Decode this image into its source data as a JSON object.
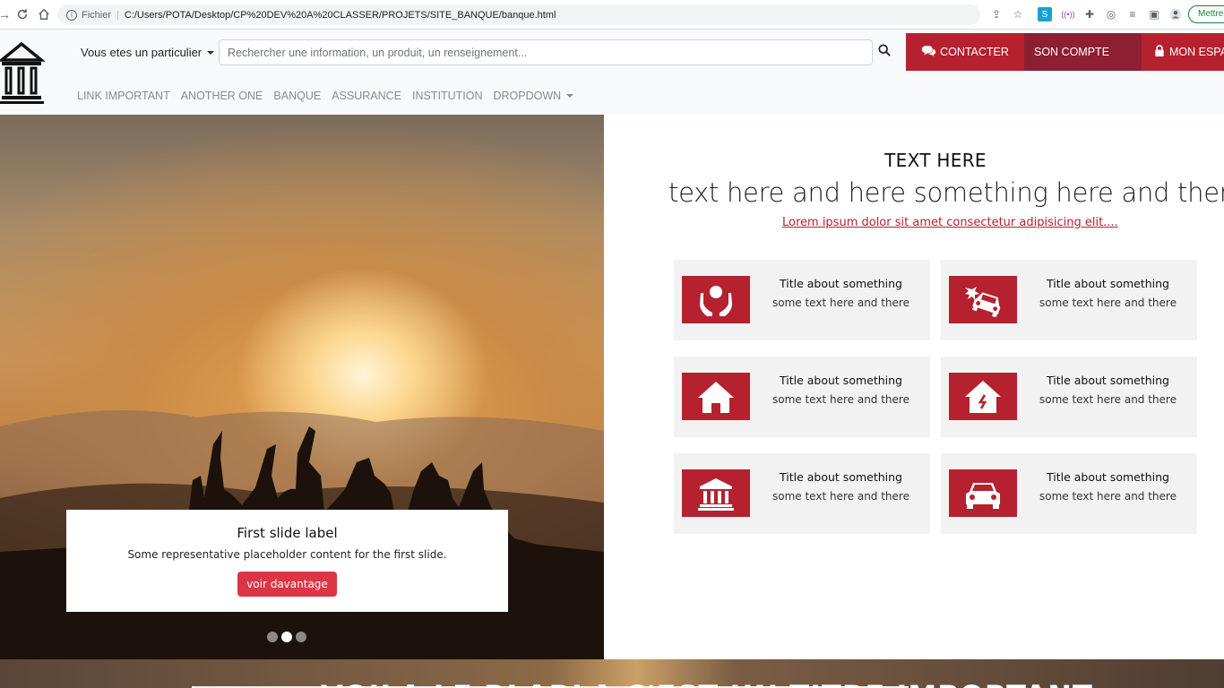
{
  "browser": {
    "fichier_label": "Fichier",
    "url": "C:/Users/POTA/Desktop/CP%20DEV%20A%20CLASSER/PROJETS/SITE_BANQUE/banque.html",
    "update_label": "Mettre"
  },
  "header": {
    "particulier": "Vous etes un particulier",
    "search_placeholder": "Rechercher une information, un produit, un renseignement...",
    "contact": "CONTACTER",
    "compte": "SON COMPTE",
    "espace": "MON ESPACE"
  },
  "nav": {
    "items": [
      "LINK IMPORTANT",
      "ANOTHER ONE",
      "BANQUE",
      "ASSURANCE",
      "INSTITUTION",
      "DROPDOWN"
    ]
  },
  "carousel": {
    "title": "First slide label",
    "text": "Some representative placeholder content for the first slide.",
    "button": "voir davantage",
    "slide_count": 3,
    "active_index": 1
  },
  "intro": {
    "heading": "TEXT HERE",
    "subheading": "text here and here something here and there....",
    "link": "Lorem ipsum dolor sit amet consectetur adipisicing elit...."
  },
  "cards": [
    {
      "icon": "hands-heart-icon",
      "title": "Title about something",
      "text": "some text here and there"
    },
    {
      "icon": "car-crash-icon",
      "title": "Title about something",
      "text": "some text here and there"
    },
    {
      "icon": "house-icon",
      "title": "Title about something",
      "text": "some text here and there"
    },
    {
      "icon": "house-repair-icon",
      "title": "Title about something",
      "text": "some text here and there"
    },
    {
      "icon": "bank-icon",
      "title": "Title about something",
      "text": "some text here and there"
    },
    {
      "icon": "car-icon",
      "title": "Title about something",
      "text": "some text here and there"
    }
  ],
  "bottom": {
    "title": "VOILA LE BLABLA C'EST UN TITRE IMPORTANT"
  },
  "colors": {
    "brand_red": "#b5212f",
    "brand_dark_red": "#8e1f33",
    "card_bg": "#f2f2f2"
  }
}
